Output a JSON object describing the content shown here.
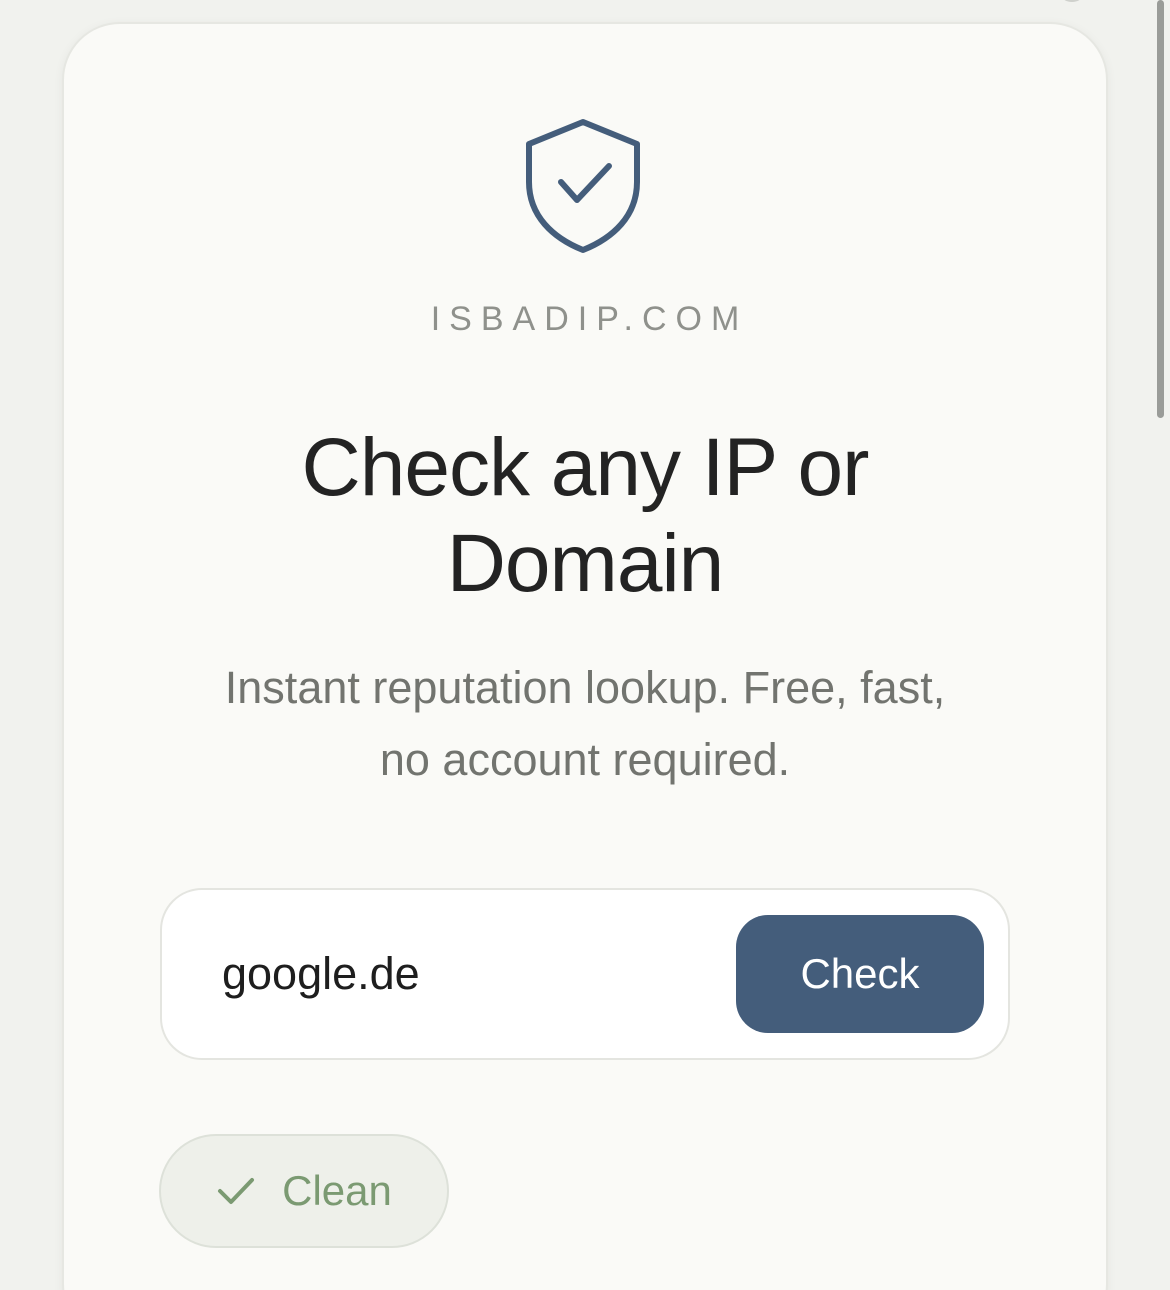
{
  "brand": {
    "name": "ISBADIP.COM",
    "icon": "shield-check-icon",
    "accent_color": "#445d7b"
  },
  "hero": {
    "title_line1": "Check any IP or",
    "title_line2": "Domain",
    "subtitle_line1": "Instant reputation lookup. Free, fast,",
    "subtitle_line2": "no account required."
  },
  "search": {
    "value": "google.de",
    "button_label": "Check"
  },
  "result": {
    "status_label": "Clean",
    "status_icon": "check-icon",
    "status_color": "#7b9a72"
  }
}
